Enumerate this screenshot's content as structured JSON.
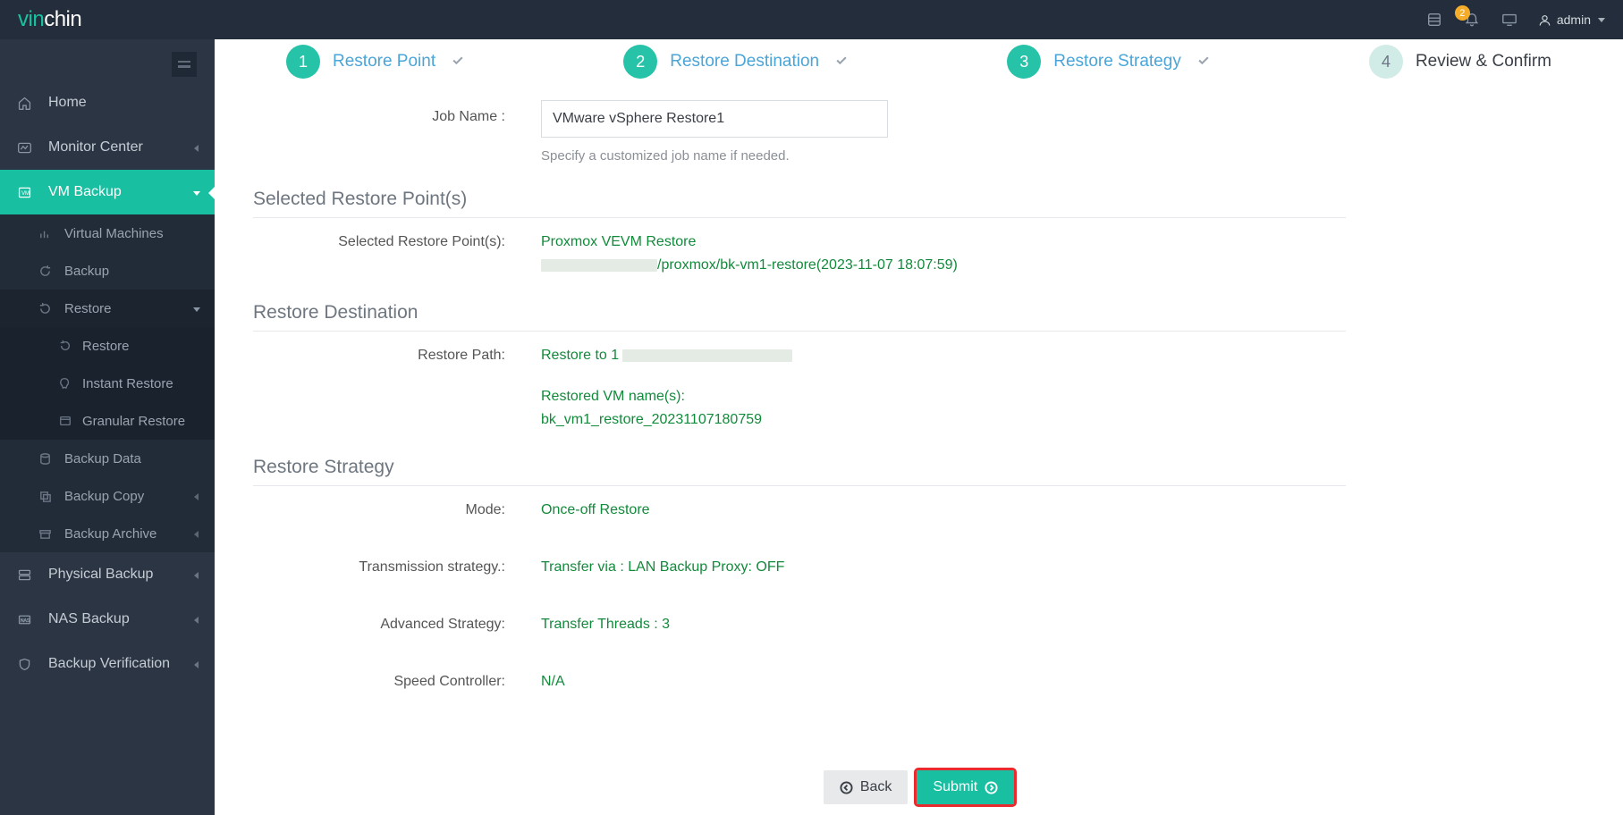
{
  "logo": {
    "pre": "vin",
    "post": "chin"
  },
  "topbar": {
    "badge": "2",
    "user": "admin"
  },
  "sidebar": {
    "home": "Home",
    "monitor": "Monitor Center",
    "vmbackup": "VM Backup",
    "vm_sub": {
      "virtual_machines": "Virtual Machines",
      "backup": "Backup",
      "restore": "Restore",
      "restore_sub": {
        "restore": "Restore",
        "instant": "Instant Restore",
        "granular": "Granular Restore"
      },
      "backup_data": "Backup Data",
      "backup_copy": "Backup Copy",
      "backup_archive": "Backup Archive"
    },
    "physical": "Physical Backup",
    "nas": "NAS Backup",
    "verify": "Backup Verification"
  },
  "wizard": {
    "s1": "Restore Point",
    "s2": "Restore Destination",
    "s3": "Restore Strategy",
    "s4": "Review & Confirm"
  },
  "form": {
    "job_name_label": "Job Name :",
    "job_name_value": "VMware vSphere Restore1",
    "job_name_hint": "Specify a customized job name if needed."
  },
  "review": {
    "restore_point_title": "Selected Restore Point(s)",
    "restore_point_label": "Selected Restore Point(s):",
    "restore_point_line1": "Proxmox VEVM Restore",
    "restore_point_line2a": "/proxmox/bk-vm1-restore(2023-11-07 18:07:59)",
    "dest_title": "Restore Destination",
    "dest_path_label": "Restore Path:",
    "dest_path_prefix": "Restore to 1",
    "dest_vm_label": "Restored VM name(s):",
    "dest_vm_value": "bk_vm1_restore_20231107180759",
    "strategy_title": "Restore Strategy",
    "mode_label": "Mode:",
    "mode_value": "Once-off Restore",
    "trans_label": "Transmission strategy.:",
    "trans_value": "Transfer via : LAN Backup Proxy: OFF",
    "adv_label": "Advanced Strategy:",
    "adv_value": "Transfer Threads : 3",
    "speed_label": "Speed Controller:",
    "speed_value": "N/A"
  },
  "buttons": {
    "back": "Back",
    "submit": "Submit"
  }
}
